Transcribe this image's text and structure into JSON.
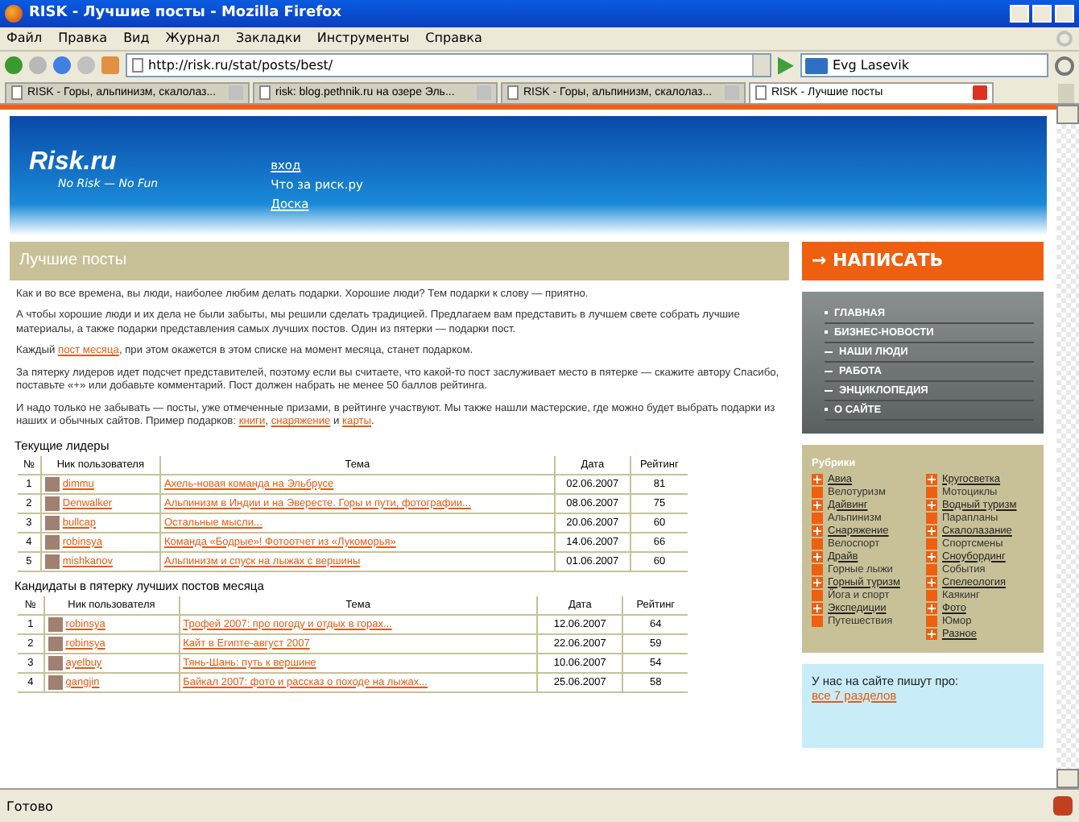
{
  "window": {
    "title": "RISK - Лучшие посты - Mozilla Firefox"
  },
  "menu": [
    "Файл",
    "Правка",
    "Вид",
    "Журнал",
    "Закладки",
    "Инструменты",
    "Справка"
  ],
  "address": {
    "value": "http://risk.ru/stat/posts/best/"
  },
  "search": {
    "value": "Evg Lasevik"
  },
  "tabs": [
    {
      "label": "RISK - Горы, альпинизм, скалолаз...",
      "selected": false
    },
    {
      "label": "risk: blog.pethnik.ru на озере Эль...",
      "selected": false
    },
    {
      "label": "RISK - Горы, альпинизм, скалолаз...",
      "selected": false
    },
    {
      "label": "RISK - Лучшие посты",
      "selected": true
    }
  ],
  "header": {
    "logo": "Risk.ru",
    "slogan": "No Risk — No Fun",
    "links": [
      "вход",
      "Что за риск.ру",
      "Доска"
    ]
  },
  "page_title": "Лучшие посты",
  "paragraphs": [
    "Как и во все времена, вы люди, наиболее любим делать подарки. Хорошие люди? Тем подарки к слову — приятно.",
    "А чтобы хорошие люди и их дела не были забыты, мы решили сделать традицией. Предлагаем вам представить в лучшем свете собрать лучшие материалы, а также подарки представления самых лучших постов. Один из пятерки — подарки пост.",
    "Каждый **пост месяца**, при этом окажется в этом списке на момент месяца, станет подарком.",
    "За пятерку лидеров идет подсчет представителей, поэтому если вы считаете, что какой-то пост заслуживает место в пятерке — скажите автору Спасибо, поставьте «+» или добавьте комментарий. Пост должен набрать не менее 50 баллов рейтинга.",
    "И надо только не забывать — посты, уже отмеченные призами, в рейтинге участвуют. Мы также нашли мастерские, где можно будет выбрать подарки из наших и обычных сайтов. Пример подарков: **книги**, **снаряжение** и **карты**."
  ],
  "tables": [
    {
      "title": "Текущие лидеры",
      "columns": [
        "№",
        "Ник пользователя",
        "Тема",
        "Дата",
        "Рейтинг"
      ],
      "rows": [
        {
          "n": "1",
          "user": "dimmu",
          "topic": "Ахель-новая команда на Эльбрусе",
          "date": "02.06.2007",
          "rating": "81"
        },
        {
          "n": "2",
          "user": "Denwalker",
          "topic": "Альпинизм в Индии и на Эвересте. Горы и пути, фотографии...",
          "date": "08.06.2007",
          "rating": "75"
        },
        {
          "n": "3",
          "user": "bullcap",
          "topic": "Остальные мысли...",
          "date": "20.06.2007",
          "rating": "60"
        },
        {
          "n": "4",
          "user": "robinsya",
          "topic": "Команда «Бодрые»! Фотоотчет из «Лукоморья»",
          "date": "14.06.2007",
          "rating": "66"
        },
        {
          "n": "5",
          "user": "mishkanov",
          "topic": "Альпинизм и спуск на лыжах с вершины",
          "date": "01.06.2007",
          "rating": "60"
        }
      ]
    },
    {
      "title": "Кандидаты в пятерку лучших постов месяца",
      "columns": [
        "№",
        "Ник пользователя",
        "Тема",
        "Дата",
        "Рейтинг"
      ],
      "rows": [
        {
          "n": "1",
          "user": "robinsya",
          "topic": "Трофей 2007: про погоду и отдых в горах...",
          "date": "12.06.2007",
          "rating": "64"
        },
        {
          "n": "2",
          "user": "robinsya",
          "topic": "Кайт в Египте-август 2007",
          "date": "22.06.2007",
          "rating": "59"
        },
        {
          "n": "3",
          "user": "ayelbuy",
          "topic": "Тянь-Шань: путь к вершине",
          "date": "10.06.2007",
          "rating": "54"
        },
        {
          "n": "4",
          "user": "gangjin",
          "topic": "Байкал 2007: фото и рассказ о походе на лыжах...",
          "date": "25.06.2007",
          "rating": "58"
        }
      ]
    }
  ],
  "write_button": "→ НАПИСАТЬ",
  "nav": [
    {
      "label": "ГЛАВНАЯ",
      "expanded": false
    },
    {
      "label": "БИЗНЕС-НОВОСТИ",
      "expanded": false
    },
    {
      "label": "НАШИ ЛЮДИ",
      "expanded": true
    },
    {
      "label": "РАБОТА",
      "expanded": true
    },
    {
      "label": "ЭНЦИКЛОПЕДИЯ",
      "expanded": true
    },
    {
      "label": "О САЙТЕ",
      "expanded": false
    }
  ],
  "rubrics": {
    "title": "Рубрики",
    "columns": [
      [
        {
          "label": "Авиа",
          "active": true
        },
        {
          "label": "Велотуризм",
          "active": false
        },
        {
          "label": "Дайвинг",
          "active": true
        },
        {
          "label": "Альпинизм",
          "active": false
        },
        {
          "label": "Снаряжение",
          "active": true
        },
        {
          "label": "Велоспорт",
          "active": false
        },
        {
          "label": "Драйв",
          "active": true
        },
        {
          "label": "Горные лыжи",
          "active": false
        },
        {
          "label": "Горный туризм",
          "active": true
        },
        {
          "label": "Йога и спорт",
          "active": false
        },
        {
          "label": "Экспедиции",
          "active": true
        },
        {
          "label": "Путешествия",
          "active": false
        }
      ],
      [
        {
          "label": "Кругосветка",
          "active": true
        },
        {
          "label": "Мотоциклы",
          "active": false
        },
        {
          "label": "Водный туризм",
          "active": true
        },
        {
          "label": "Парапланы",
          "active": false
        },
        {
          "label": "Скалолазание",
          "active": true
        },
        {
          "label": "Спортсмены",
          "active": false
        },
        {
          "label": "Сноубординг",
          "active": true
        },
        {
          "label": "События",
          "active": false
        },
        {
          "label": "Спелеология",
          "active": true
        },
        {
          "label": "Каякинг",
          "active": false
        },
        {
          "label": "Фото",
          "active": true
        },
        {
          "label": "Юмор",
          "active": false
        },
        {
          "label": "Разное",
          "active": true
        }
      ]
    ]
  },
  "about": {
    "title": "У нас на сайте пишут про:",
    "link": "все 7 разделов"
  },
  "status_bar": "Готово"
}
